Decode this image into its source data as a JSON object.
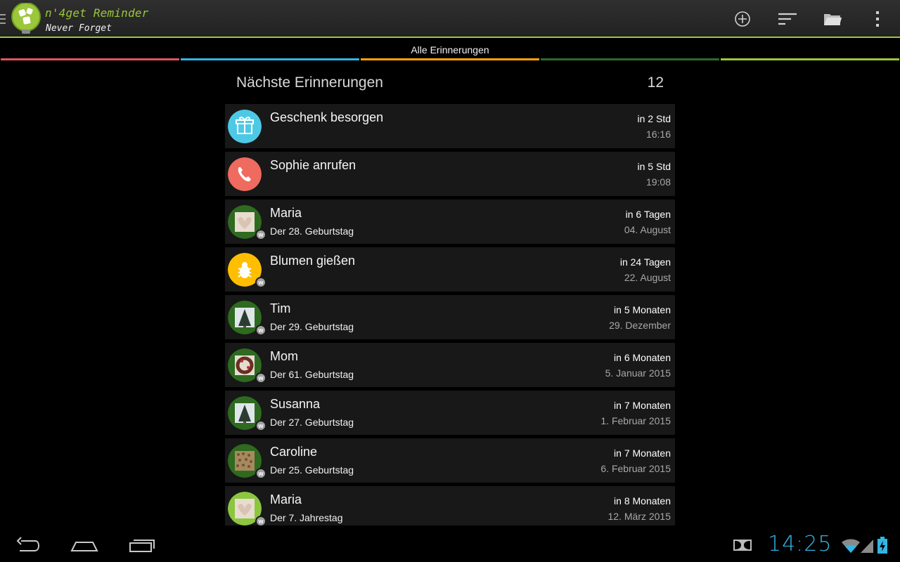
{
  "app": {
    "title": "n'4get Reminder",
    "subtitle": "Never Forget"
  },
  "actions": {
    "add": "add-icon",
    "sort": "sort-icon",
    "folder": "folder-icon",
    "overflow": "overflow-icon"
  },
  "tabs": [
    {
      "label": "",
      "color": "#e0545d"
    },
    {
      "label": "",
      "color": "#33b5e5"
    },
    {
      "label": "Alle Erinnerungen",
      "color": "#ffa500"
    },
    {
      "label": "",
      "color": "#2d6b2d"
    },
    {
      "label": "",
      "color": "#9bc73a"
    }
  ],
  "list": {
    "title": "Nächste Erinnerungen",
    "count": "12",
    "items": [
      {
        "title": "Geschenk besorgen",
        "subtitle": "",
        "when": "in 2 Std",
        "date": "16:16",
        "icon": "gift-icon",
        "badge": ""
      },
      {
        "title": "Sophie anrufen",
        "subtitle": "",
        "when": "in 5 Std",
        "date": "19:08",
        "icon": "phone-icon",
        "badge": ""
      },
      {
        "title": "Maria",
        "subtitle": "Der 28. Geburtstag",
        "when": "in 6 Tagen",
        "date": "04. August",
        "icon": "contact-photo",
        "badge": "w"
      },
      {
        "title": "Blumen gießen",
        "subtitle": "",
        "when": "in 24 Tagen",
        "date": "22. August",
        "icon": "bug-icon",
        "badge": "w"
      },
      {
        "title": "Tim",
        "subtitle": "Der 29. Geburtstag",
        "when": "in 5 Monaten",
        "date": "29. Dezember",
        "icon": "contact-photo",
        "badge": "w"
      },
      {
        "title": "Mom",
        "subtitle": "Der 61. Geburtstag",
        "when": "in 6 Monaten",
        "date": "5. Januar 2015",
        "icon": "contact-photo",
        "badge": "w"
      },
      {
        "title": "Susanna",
        "subtitle": "Der 27. Geburtstag",
        "when": "in 7 Monaten",
        "date": "1. Februar 2015",
        "icon": "contact-photo",
        "badge": "w"
      },
      {
        "title": "Caroline",
        "subtitle": "Der 25. Geburtstag",
        "when": "in 7 Monaten",
        "date": "6. Februar 2015",
        "icon": "contact-photo",
        "badge": "w"
      },
      {
        "title": "Maria",
        "subtitle": "Der 7. Jahrestag",
        "when": "in 8 Monaten",
        "date": "12. März 2015",
        "icon": "contact-photo",
        "badge": "w"
      }
    ]
  },
  "system": {
    "clock": "14:25"
  }
}
